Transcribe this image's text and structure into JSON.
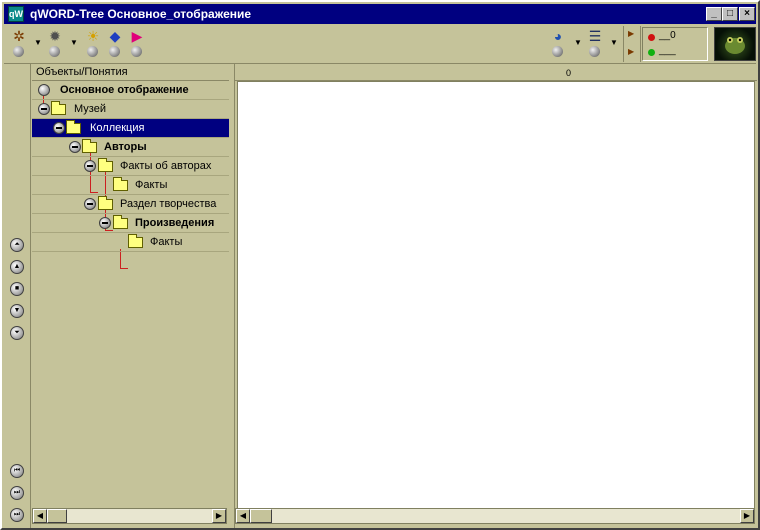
{
  "window": {
    "app_icon_text": "qW",
    "title": "qWORD-Tree Основное_отображение",
    "controls": {
      "minimize": "_",
      "maximize": "□",
      "close": "×"
    }
  },
  "toolbar": {
    "tools_left": [
      {
        "icon": "network-nodes-icon",
        "glyph": "✲",
        "has_dropdown": true
      },
      {
        "icon": "settings-gear-icon",
        "glyph": "✹",
        "has_dropdown": true
      },
      {
        "icon": "sun-burst-icon",
        "glyph": "☀",
        "has_dropdown": false
      },
      {
        "icon": "color-shapes-icon",
        "glyph": "◆",
        "has_dropdown": false
      },
      {
        "icon": "flag-arrow-icon",
        "glyph": "▶",
        "has_dropdown": false
      }
    ],
    "tools_right": [
      {
        "icon": "pie-chart-icon",
        "glyph": "◕",
        "has_dropdown": true
      },
      {
        "icon": "list-bullets-icon",
        "glyph": "☰",
        "has_dropdown": true
      }
    ],
    "status": {
      "red_value": "__0",
      "green_value": "___"
    }
  },
  "left_pane": {
    "header": "Объекты/Понятия",
    "tree": [
      {
        "label": "Основное отображение",
        "level": 0,
        "bold": true,
        "selected": false,
        "folder": false
      },
      {
        "label": "Музей",
        "level": 1,
        "bold": false,
        "selected": false,
        "folder": true
      },
      {
        "label": "Коллекция",
        "level": 2,
        "bold": false,
        "selected": true,
        "folder": true
      },
      {
        "label": "Авторы",
        "level": 3,
        "bold": true,
        "selected": false,
        "folder": true
      },
      {
        "label": "Факты об авторах",
        "level": 4,
        "bold": false,
        "selected": false,
        "folder": true
      },
      {
        "label": "Факты",
        "level": 5,
        "bold": false,
        "selected": false,
        "folder": true
      },
      {
        "label": "Раздел творчества",
        "level": 4,
        "bold": false,
        "selected": false,
        "folder": true
      },
      {
        "label": "Произведения",
        "level": 5,
        "bold": true,
        "selected": false,
        "folder": true
      },
      {
        "label": "Факты",
        "level": 6,
        "bold": false,
        "selected": false,
        "folder": true
      }
    ]
  },
  "right_pane": {
    "ruler_label": "0"
  },
  "scroll": {
    "left": "◀",
    "right": "▶"
  },
  "nav": {
    "top": [
      "⏶",
      "▲",
      "■",
      "▼",
      "⏷"
    ],
    "bottom": [
      "⏮",
      "⏭",
      "⏭"
    ]
  }
}
